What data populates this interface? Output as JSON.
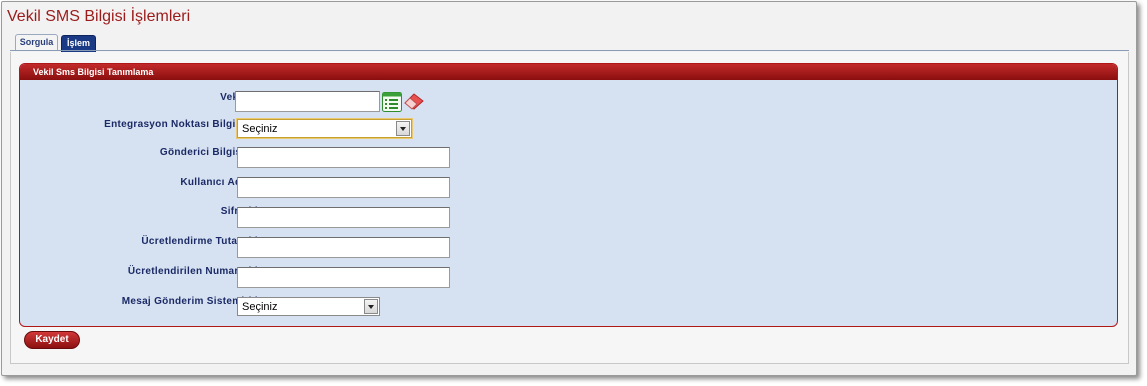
{
  "page": {
    "title": "Vekil SMS Bilgisi İşlemleri"
  },
  "tabs": [
    {
      "label": "Sorgula",
      "active": false
    },
    {
      "label": "İşlem",
      "active": true
    }
  ],
  "section": {
    "title": "Vekil Sms Bilgisi Tanımlama"
  },
  "form": {
    "vekil": {
      "label": "Vekil (*)",
      "value": ""
    },
    "entegrasyon": {
      "label": "Entegrasyon Noktası Bilgisi (*)",
      "selected": "Seçiniz"
    },
    "gonderici": {
      "label": "Gönderici Bilgisi (*)",
      "value": ""
    },
    "kullanici": {
      "label": "Kullanıcı Adı (*)",
      "value": ""
    },
    "sifre": {
      "label": "Sifre (*)",
      "value": ""
    },
    "tutar": {
      "label": "Ücretlendirme Tutarı (*)",
      "value": ""
    },
    "numara": {
      "label": "Ücretlendirilen Numara (*)",
      "value": ""
    },
    "mesaj_sistemi": {
      "label": "Mesaj Gönderim Sistemi (*)",
      "selected": "Seçiniz"
    }
  },
  "icons": {
    "lookup": "list-lookup-icon",
    "clear": "eraser-icon"
  },
  "actions": {
    "save_label": "Kaydet"
  },
  "colors": {
    "brand_red": "#9b1b1b",
    "section_bg": "#d6e1f1",
    "label_navy": "#1b2a66",
    "active_tab": "#1b3a86"
  }
}
